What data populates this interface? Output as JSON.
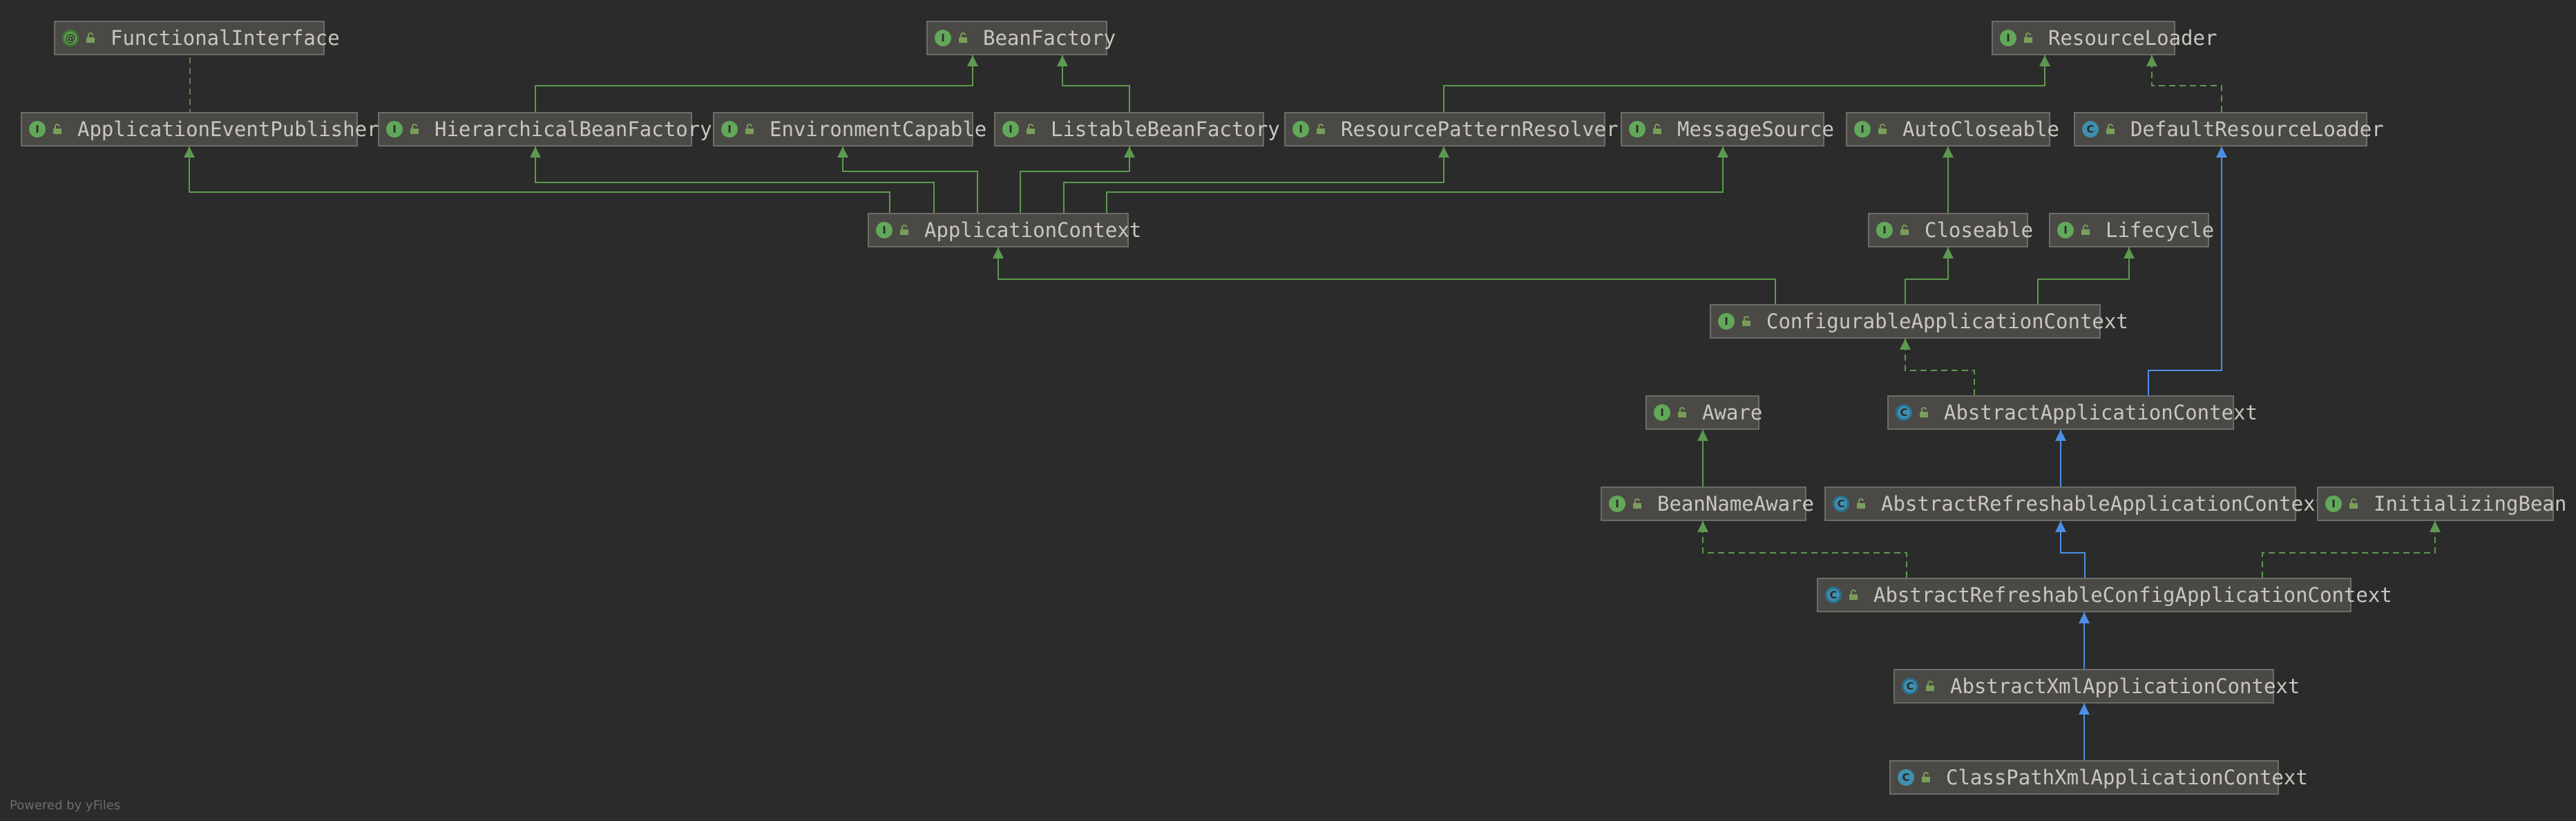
{
  "diagram": {
    "colors": {
      "background": "#2b2b2b",
      "node_fill": "#4a4945",
      "node_border": "#6e6c66",
      "interface_edge": "#5c9a4f",
      "class_edge": "#4d8fe6",
      "text": "#c8c6bf"
    },
    "nodes": [
      {
        "id": "FunctionalInterface",
        "label": "FunctionalInterface",
        "kind": "annotation",
        "badge": "@"
      },
      {
        "id": "BeanFactory",
        "label": "BeanFactory",
        "kind": "interface",
        "badge": "I"
      },
      {
        "id": "ResourceLoader",
        "label": "ResourceLoader",
        "kind": "interface",
        "badge": "I"
      },
      {
        "id": "ApplicationEventPublisher",
        "label": "ApplicationEventPublisher",
        "kind": "interface",
        "badge": "I"
      },
      {
        "id": "HierarchicalBeanFactory",
        "label": "HierarchicalBeanFactory",
        "kind": "interface",
        "badge": "I"
      },
      {
        "id": "EnvironmentCapable",
        "label": "EnvironmentCapable",
        "kind": "interface",
        "badge": "I"
      },
      {
        "id": "ListableBeanFactory",
        "label": "ListableBeanFactory",
        "kind": "interface",
        "badge": "I"
      },
      {
        "id": "ResourcePatternResolver",
        "label": "ResourcePatternResolver",
        "kind": "interface",
        "badge": "I"
      },
      {
        "id": "MessageSource",
        "label": "MessageSource",
        "kind": "interface",
        "badge": "I"
      },
      {
        "id": "AutoCloseable",
        "label": "AutoCloseable",
        "kind": "interface",
        "badge": "I"
      },
      {
        "id": "DefaultResourceLoader",
        "label": "DefaultResourceLoader",
        "kind": "class",
        "badge": "C"
      },
      {
        "id": "ApplicationContext",
        "label": "ApplicationContext",
        "kind": "interface",
        "badge": "I"
      },
      {
        "id": "Closeable",
        "label": "Closeable",
        "kind": "interface",
        "badge": "I"
      },
      {
        "id": "Lifecycle",
        "label": "Lifecycle",
        "kind": "interface",
        "badge": "I"
      },
      {
        "id": "ConfigurableApplicationContext",
        "label": "ConfigurableApplicationContext",
        "kind": "interface",
        "badge": "I"
      },
      {
        "id": "Aware",
        "label": "Aware",
        "kind": "interface",
        "badge": "I"
      },
      {
        "id": "AbstractApplicationContext",
        "label": "AbstractApplicationContext",
        "kind": "abstract",
        "badge": "C"
      },
      {
        "id": "BeanNameAware",
        "label": "BeanNameAware",
        "kind": "interface",
        "badge": "I"
      },
      {
        "id": "AbstractRefreshableApplicationContext",
        "label": "AbstractRefreshableApplicationContext",
        "kind": "abstract",
        "badge": "C"
      },
      {
        "id": "InitializingBean",
        "label": "InitializingBean",
        "kind": "interface",
        "badge": "I"
      },
      {
        "id": "AbstractRefreshableConfigApplicationContext",
        "label": "AbstractRefreshableConfigApplicationContext",
        "kind": "abstract",
        "badge": "C"
      },
      {
        "id": "AbstractXmlApplicationContext",
        "label": "AbstractXmlApplicationContext",
        "kind": "abstract",
        "badge": "C"
      },
      {
        "id": "ClassPathXmlApplicationContext",
        "label": "ClassPathXmlApplicationContext",
        "kind": "class",
        "badge": "C"
      }
    ],
    "edges": [
      {
        "from": "ApplicationEventPublisher",
        "to": "FunctionalInterface",
        "type": "annotation"
      },
      {
        "from": "HierarchicalBeanFactory",
        "to": "BeanFactory",
        "type": "extends"
      },
      {
        "from": "ListableBeanFactory",
        "to": "BeanFactory",
        "type": "extends"
      },
      {
        "from": "ResourcePatternResolver",
        "to": "ResourceLoader",
        "type": "extends"
      },
      {
        "from": "DefaultResourceLoader",
        "to": "ResourceLoader",
        "type": "implements"
      },
      {
        "from": "ApplicationContext",
        "to": "ApplicationEventPublisher",
        "type": "extends"
      },
      {
        "from": "ApplicationContext",
        "to": "HierarchicalBeanFactory",
        "type": "extends"
      },
      {
        "from": "ApplicationContext",
        "to": "EnvironmentCapable",
        "type": "extends"
      },
      {
        "from": "ApplicationContext",
        "to": "ListableBeanFactory",
        "type": "extends"
      },
      {
        "from": "ApplicationContext",
        "to": "ResourcePatternResolver",
        "type": "extends"
      },
      {
        "from": "ApplicationContext",
        "to": "MessageSource",
        "type": "extends"
      },
      {
        "from": "Closeable",
        "to": "AutoCloseable",
        "type": "extends"
      },
      {
        "from": "ConfigurableApplicationContext",
        "to": "ApplicationContext",
        "type": "extends"
      },
      {
        "from": "ConfigurableApplicationContext",
        "to": "Closeable",
        "type": "extends"
      },
      {
        "from": "ConfigurableApplicationContext",
        "to": "Lifecycle",
        "type": "extends"
      },
      {
        "from": "AbstractApplicationContext",
        "to": "ConfigurableApplicationContext",
        "type": "implements"
      },
      {
        "from": "AbstractApplicationContext",
        "to": "DefaultResourceLoader",
        "type": "class-extends"
      },
      {
        "from": "BeanNameAware",
        "to": "Aware",
        "type": "extends"
      },
      {
        "from": "AbstractRefreshableApplicationContext",
        "to": "AbstractApplicationContext",
        "type": "class-extends"
      },
      {
        "from": "AbstractRefreshableConfigApplicationContext",
        "to": "AbstractRefreshableApplicationContext",
        "type": "class-extends"
      },
      {
        "from": "AbstractRefreshableConfigApplicationContext",
        "to": "BeanNameAware",
        "type": "implements"
      },
      {
        "from": "AbstractRefreshableConfigApplicationContext",
        "to": "InitializingBean",
        "type": "implements"
      },
      {
        "from": "AbstractXmlApplicationContext",
        "to": "AbstractRefreshableConfigApplicationContext",
        "type": "class-extends"
      },
      {
        "from": "ClassPathXmlApplicationContext",
        "to": "AbstractXmlApplicationContext",
        "type": "class-extends"
      }
    ]
  },
  "footer": {
    "text": "Powered by yFiles"
  }
}
